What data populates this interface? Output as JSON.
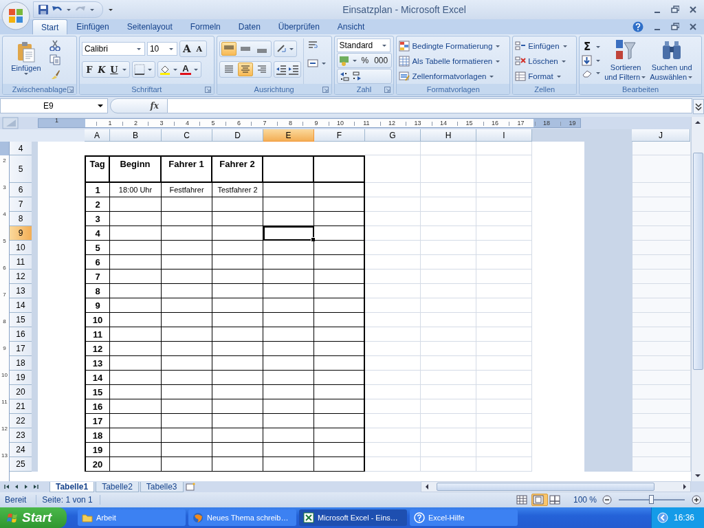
{
  "window": {
    "title": "Einsatzplan - Microsoft Excel"
  },
  "tabs": [
    {
      "label": "Start",
      "selected": true
    },
    {
      "label": "Einfügen",
      "selected": false
    },
    {
      "label": "Seitenlayout",
      "selected": false
    },
    {
      "label": "Formeln",
      "selected": false
    },
    {
      "label": "Daten",
      "selected": false
    },
    {
      "label": "Überprüfen",
      "selected": false
    },
    {
      "label": "Ansicht",
      "selected": false
    }
  ],
  "ribbon": [
    {
      "kind": "clipboard",
      "label": "Zwischenablage",
      "launcher": true,
      "paste": "Einfügen"
    },
    {
      "kind": "font",
      "label": "Schriftart",
      "launcher": true,
      "font": "Calibri",
      "size": "10",
      "grow": "A",
      "shrink": "A",
      "bold": "F",
      "italic": "K",
      "underline": "U",
      "color_letter": "A"
    },
    {
      "kind": "alignment",
      "label": "Ausrichtung",
      "launcher": true,
      "vertical": [
        {
          "selected": true
        },
        {
          "selected": false
        },
        {
          "selected": false
        }
      ],
      "horizontal": [
        {
          "selected": false
        },
        {
          "selected": true
        },
        {
          "selected": false
        }
      ]
    },
    {
      "kind": "number",
      "label": "Zahl",
      "launcher": true,
      "format": "Standard",
      "percent": "%",
      "thousands": "000"
    },
    {
      "kind": "styles",
      "label": "Formatvorlagen",
      "launcher": false,
      "items": [
        "Bedingte Formatierung",
        "Als Tabelle formatieren",
        "Zellenformatvorlagen"
      ]
    },
    {
      "kind": "cells",
      "label": "Zellen",
      "launcher": false,
      "items": [
        "Einfügen",
        "Löschen",
        "Format"
      ]
    },
    {
      "kind": "editing",
      "label": "Bearbeiten",
      "launcher": false,
      "sum": "Σ",
      "sort": [
        "Sortieren",
        "und Filtern"
      ],
      "find": [
        "Suchen und",
        "Auswählen"
      ]
    }
  ],
  "formula_bar": {
    "name_box": "E9",
    "fx": "fx"
  },
  "ruler": {
    "horizontal": [
      "1",
      "1",
      "2",
      "3",
      "4",
      "5",
      "6",
      "7",
      "8",
      "9",
      "10",
      "11",
      "12",
      "13",
      "14",
      "15",
      "16",
      "17",
      "18",
      "19"
    ],
    "vertical": [
      "2",
      "3",
      "4",
      "5",
      "6",
      "7",
      "8",
      "9",
      "10",
      "11",
      "12",
      "13"
    ]
  },
  "sheet": {
    "columns": [
      {
        "label": "A",
        "selected": false
      },
      {
        "label": "B",
        "selected": false
      },
      {
        "label": "C",
        "selected": false
      },
      {
        "label": "D",
        "selected": false
      },
      {
        "label": "E",
        "selected": true
      },
      {
        "label": "F",
        "selected": false
      },
      {
        "label": "G",
        "selected": false
      },
      {
        "label": "H",
        "selected": false
      },
      {
        "label": "I",
        "selected": false
      },
      {
        "label": "J",
        "selected": false
      }
    ],
    "rows": [
      {
        "header": "4",
        "selected": false,
        "kind": "blank",
        "cells": []
      },
      {
        "header": "5",
        "selected": false,
        "kind": "header",
        "cells": [
          "Tag",
          "Beginn",
          "Fahrer 1",
          "Fahrer 2"
        ]
      },
      {
        "header": "6",
        "selected": false,
        "kind": "data",
        "cells": [
          "1",
          "18:00 Uhr",
          "Festfahrer",
          "Testfahrer 2"
        ]
      },
      {
        "header": "7",
        "selected": false,
        "kind": "data",
        "cells": [
          "2"
        ]
      },
      {
        "header": "8",
        "selected": false,
        "kind": "data",
        "cells": [
          "3"
        ]
      },
      {
        "header": "9",
        "selected": true,
        "kind": "data",
        "cells": [
          "4"
        ]
      },
      {
        "header": "10",
        "selected": false,
        "kind": "data",
        "cells": [
          "5"
        ]
      },
      {
        "header": "11",
        "selected": false,
        "kind": "data",
        "cells": [
          "6"
        ]
      },
      {
        "header": "12",
        "selected": false,
        "kind": "data",
        "cells": [
          "7"
        ]
      },
      {
        "header": "13",
        "selected": false,
        "kind": "data",
        "cells": [
          "8"
        ]
      },
      {
        "header": "14",
        "selected": false,
        "kind": "data",
        "cells": [
          "9"
        ]
      },
      {
        "header": "15",
        "selected": false,
        "kind": "data",
        "cells": [
          "10"
        ]
      },
      {
        "header": "16",
        "selected": false,
        "kind": "data",
        "cells": [
          "11"
        ]
      },
      {
        "header": "17",
        "selected": false,
        "kind": "data",
        "cells": [
          "12"
        ]
      },
      {
        "header": "18",
        "selected": false,
        "kind": "data",
        "cells": [
          "13"
        ]
      },
      {
        "header": "19",
        "selected": false,
        "kind": "data",
        "cells": [
          "14"
        ]
      },
      {
        "header": "20",
        "selected": false,
        "kind": "data",
        "cells": [
          "15"
        ]
      },
      {
        "header": "21",
        "selected": false,
        "kind": "data",
        "cells": [
          "16"
        ]
      },
      {
        "header": "22",
        "selected": false,
        "kind": "data",
        "cells": [
          "17"
        ]
      },
      {
        "header": "23",
        "selected": false,
        "kind": "data",
        "cells": [
          "18"
        ]
      },
      {
        "header": "24",
        "selected": false,
        "kind": "data",
        "cells": [
          "19"
        ]
      },
      {
        "header": "25",
        "selected": false,
        "kind": "data",
        "cells": [
          "20"
        ]
      }
    ]
  },
  "sheet_tabs": [
    {
      "label": "Tabelle1",
      "selected": true
    },
    {
      "label": "Tabelle2",
      "selected": false
    },
    {
      "label": "Tabelle3",
      "selected": false
    }
  ],
  "status_bar": {
    "mode": "Bereit",
    "page": "Seite: 1 von 1",
    "views": [
      {
        "selected": false
      },
      {
        "selected": true
      },
      {
        "selected": false
      }
    ],
    "zoom": "100 %",
    "level": 0.5
  },
  "taskbar": {
    "start": "Start",
    "items": [
      {
        "label": "Arbeit",
        "kind": "folder",
        "selected": false
      },
      {
        "label": "Neues Thema schreib…",
        "kind": "browser",
        "selected": false
      },
      {
        "label": "Microsoft Excel - Eins…",
        "kind": "excel",
        "selected": true
      },
      {
        "label": "Excel-Hilfe",
        "kind": "help",
        "selected": false
      }
    ],
    "clock": "16:36"
  }
}
